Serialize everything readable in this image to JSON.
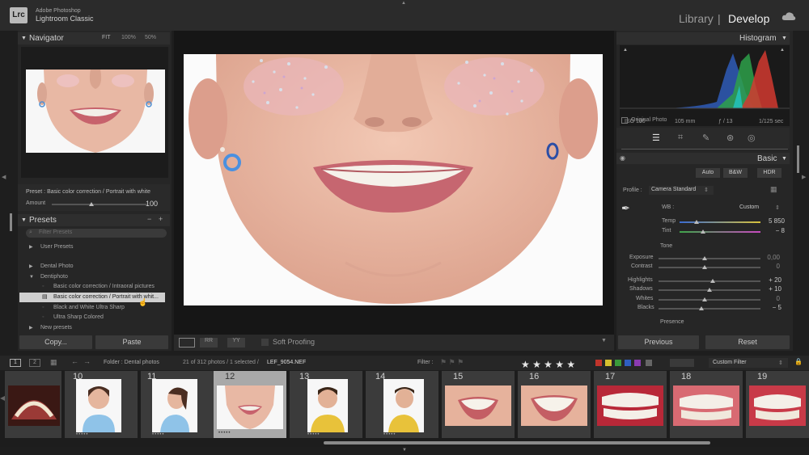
{
  "app": {
    "brand_line1": "Adobe Photoshop",
    "brand_line2": "Lightroom Classic",
    "logo": "Lrc",
    "modules": {
      "library": "Library",
      "separator": "|",
      "develop": "Develop"
    }
  },
  "left": {
    "navigator": {
      "title": "Navigator",
      "zoom_fit": "FIT",
      "zoom_100": "100%",
      "zoom_50": "50%"
    },
    "preset_line": "Preset : Basic color correction / Portrait with white",
    "amount_label": "Amount",
    "amount_value": "100",
    "presets": {
      "title": "Presets",
      "search_placeholder": "Filter Presets",
      "items": [
        "User Presets",
        "Dental Photo",
        "Dentiphoto",
        "Basic color correction / Intraoral pictures",
        "Basic color correction / Portrait with whit...",
        "Black and White Ultra Sharp",
        "Ultra Sharp Colored",
        "New presets"
      ]
    },
    "copy": "Copy...",
    "paste": "Paste"
  },
  "center": {
    "soft_proofing": "Soft Proofing"
  },
  "right": {
    "histogram": {
      "title": "Histogram",
      "iso": "ISO 100",
      "focal": "105 mm",
      "aperture": "ƒ / 13",
      "shutter": "1/125 sec",
      "original": "Original Photo"
    },
    "basic": {
      "title": "Basic",
      "auto": "Auto",
      "bw": "B&W",
      "hdr": "HDR",
      "profile_label": "Profile :",
      "profile_value": "Camera Standard",
      "wb_label": "WB :",
      "wb_value": "Custom",
      "temp_label": "Temp",
      "temp_value": "5 850",
      "tint_label": "Tint",
      "tint_value": "− 8",
      "tone": "Tone",
      "exposure": "Exposure",
      "exposure_v": "0,00",
      "contrast": "Contrast",
      "contrast_v": "0",
      "highlights": "Highlights",
      "highlights_v": "+ 20",
      "shadows": "Shadows",
      "shadows_v": "+ 10",
      "whites": "Whites",
      "whites_v": "0",
      "blacks": "Blacks",
      "blacks_v": "− 5",
      "presence": "Presence"
    },
    "previous": "Previous",
    "reset": "Reset"
  },
  "filmbar": {
    "page1": "1",
    "page2": "2",
    "folder": "Folder : Dental photos",
    "count": "21 of 312 photos / 1 selected /",
    "file": "LEF_9054.NEF",
    "filter_label": "Filter :",
    "custom_filter": "Custom Filter"
  },
  "film": {
    "numbers": [
      "10",
      "11",
      "12",
      "13",
      "14",
      "15",
      "16",
      "17",
      "18",
      "19"
    ],
    "stars": "★ ★ ★ ★ ★",
    "rating_dots": "•••••"
  },
  "colors": {
    "accent": "#f2f2f2",
    "panel": "#262626",
    "selected_cell": "#a9a9a9"
  }
}
